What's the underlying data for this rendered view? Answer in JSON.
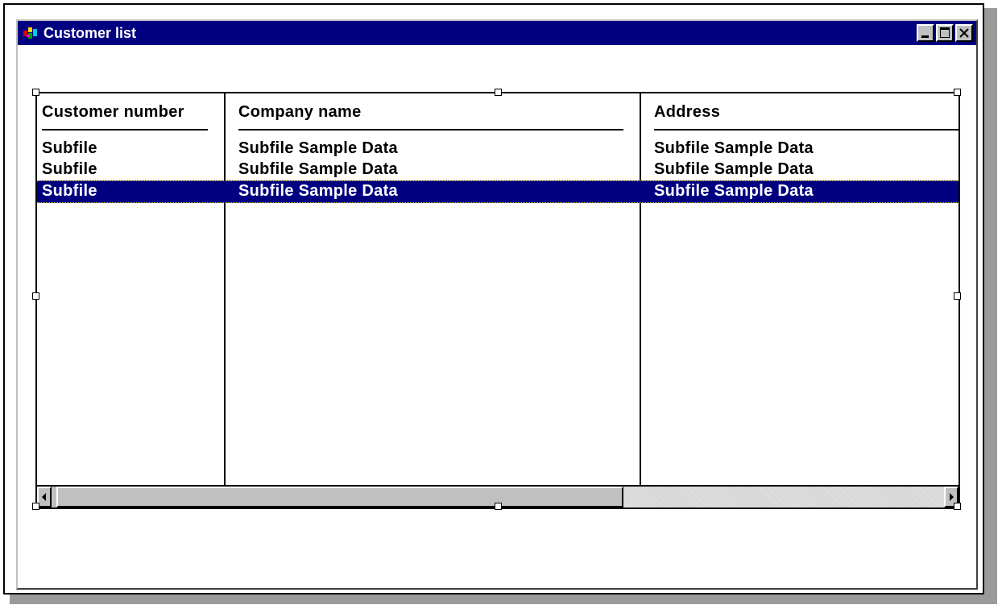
{
  "window": {
    "title": "Customer list",
    "icon": "app-icon",
    "controls": [
      "minimize-icon",
      "maximize-icon",
      "close-icon"
    ]
  },
  "grid": {
    "columns": [
      "Customer number",
      "Company name",
      "Address"
    ],
    "rows": [
      [
        "Subfile",
        "Subfile Sample Data",
        "Subfile Sample Data"
      ],
      [
        "Subfile",
        "Subfile Sample Data",
        "Subfile Sample Data"
      ],
      [
        "Subfile",
        "Subfile Sample Data",
        "Subfile Sample Data"
      ]
    ],
    "selected_row": 3
  },
  "colors": {
    "titlebar": "#000080",
    "selection": "#000080",
    "chrome": "#c0c0c0"
  }
}
